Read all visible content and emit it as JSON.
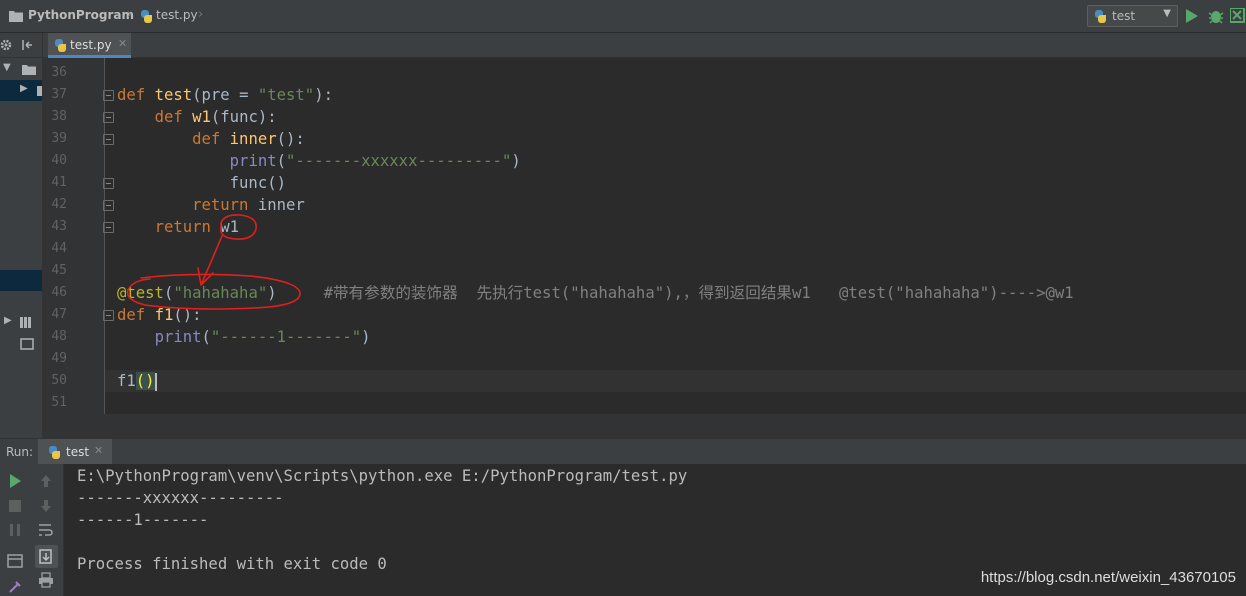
{
  "navbar": {
    "project": "PythonProgram",
    "file": "test.py",
    "run_config": "test"
  },
  "colors": {
    "keyword": "#CC7832",
    "function_name": "#FFC66D",
    "string": "#6A8759",
    "builtin": "#8888C6",
    "decorator": "#BBB529",
    "comment": "#808080",
    "run_green": "#59A869",
    "annotation_red": "#E0201D"
  },
  "editor": {
    "tab_label": "test.py",
    "lines": [
      {
        "num": "36",
        "parts": []
      },
      {
        "num": "37",
        "parts": [
          [
            "kw",
            "def "
          ],
          [
            "fn",
            "test"
          ],
          [
            "p",
            "(pre = "
          ],
          [
            "str",
            "\"test\""
          ],
          [
            "p",
            "):"
          ]
        ]
      },
      {
        "num": "38",
        "parts": [
          [
            "p",
            "    "
          ],
          [
            "kw",
            "def "
          ],
          [
            "fn",
            "w1"
          ],
          [
            "p",
            "(func):"
          ]
        ]
      },
      {
        "num": "39",
        "parts": [
          [
            "p",
            "        "
          ],
          [
            "kw",
            "def "
          ],
          [
            "fn",
            "inner"
          ],
          [
            "p",
            "():"
          ]
        ]
      },
      {
        "num": "40",
        "parts": [
          [
            "p",
            "            "
          ],
          [
            "bi",
            "print"
          ],
          [
            "p",
            "("
          ],
          [
            "str",
            "\"-------xxxxxx---------\""
          ],
          [
            "p",
            ")"
          ]
        ]
      },
      {
        "num": "41",
        "parts": [
          [
            "p",
            "            func()"
          ]
        ]
      },
      {
        "num": "42",
        "parts": [
          [
            "p",
            "        "
          ],
          [
            "kw",
            "return "
          ],
          [
            "p",
            "inner"
          ]
        ]
      },
      {
        "num": "43",
        "parts": [
          [
            "p",
            "    "
          ],
          [
            "kw",
            "return "
          ],
          [
            "p",
            "w1"
          ]
        ]
      },
      {
        "num": "44",
        "parts": []
      },
      {
        "num": "45",
        "parts": []
      },
      {
        "num": "46",
        "parts": [
          [
            "dec",
            "@test"
          ],
          [
            "p",
            "("
          ],
          [
            "str",
            "\"hahahaha\""
          ],
          [
            "p",
            ")     "
          ],
          [
            "cmt",
            "#带有参数的装饰器  先执行test(\"hahahaha\"),，得到返回结果w1   @test(\"hahahaha\")---->@w1"
          ]
        ]
      },
      {
        "num": "47",
        "parts": [
          [
            "kw",
            "def "
          ],
          [
            "fn",
            "f1"
          ],
          [
            "p",
            "():"
          ]
        ]
      },
      {
        "num": "48",
        "parts": [
          [
            "p",
            "    "
          ],
          [
            "bi",
            "print"
          ],
          [
            "p",
            "("
          ],
          [
            "str",
            "\"------1-------\""
          ],
          [
            "p",
            ")"
          ]
        ]
      },
      {
        "num": "49",
        "parts": []
      },
      {
        "num": "50",
        "parts": [
          [
            "p",
            "f1"
          ],
          [
            "hl",
            "()"
          ],
          [
            "cursor",
            ""
          ]
        ]
      },
      {
        "num": "51",
        "parts": []
      }
    ]
  },
  "run": {
    "label": "Run:",
    "tab_label": "test",
    "console": [
      "E:\\PythonProgram\\venv\\Scripts\\python.exe E:/PythonProgram/test.py",
      "-------xxxxxx---------",
      "------1-------",
      "",
      "Process finished with exit code 0"
    ]
  },
  "watermark": "https://blog.csdn.net/weixin_43670105"
}
